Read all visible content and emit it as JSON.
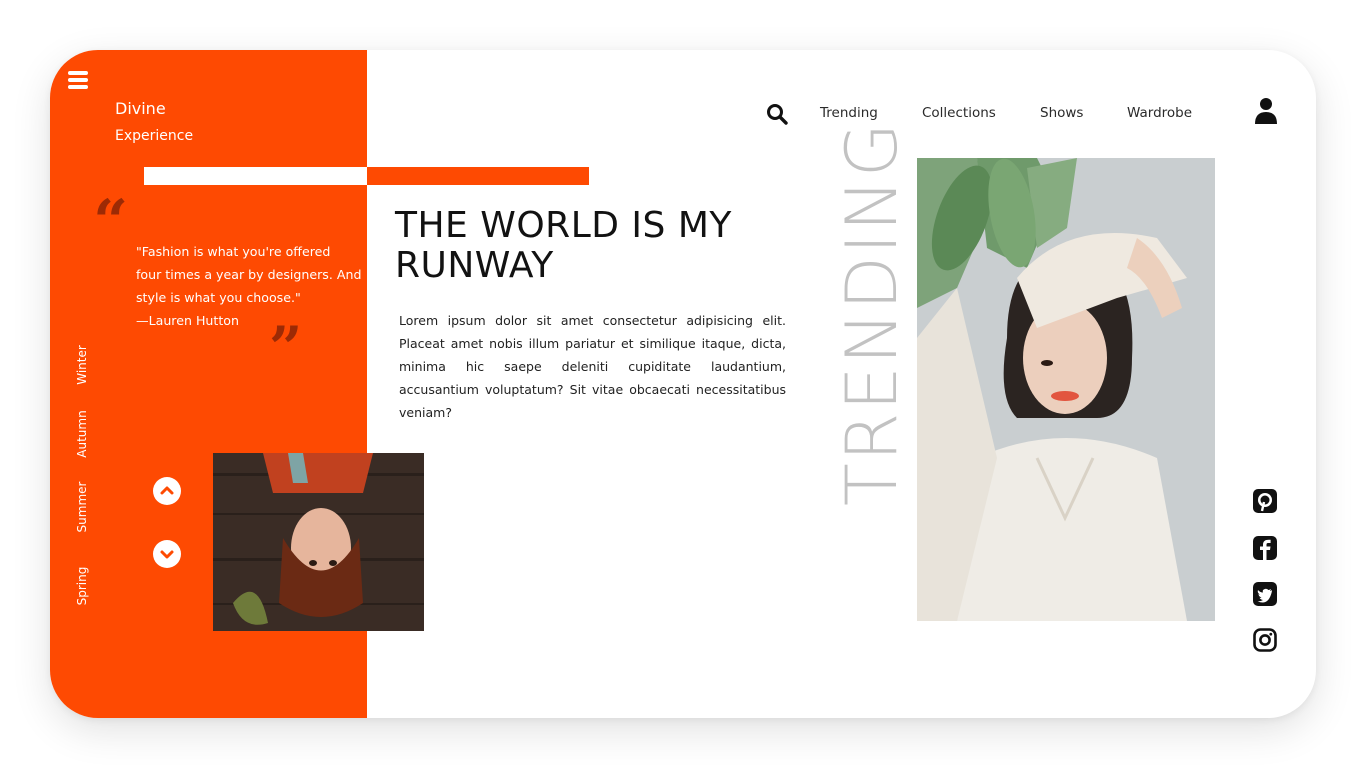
{
  "brand": {
    "title": "Divine",
    "subtitle": "Experience"
  },
  "quote": {
    "line1": "\"Fashion is what you're offered",
    "line2": "four times a year by designers. And",
    "line3": "style is what you choose.\"",
    "author": "—Lauren Hutton"
  },
  "seasons": [
    "Winter",
    "Autumn",
    "Summer",
    "Spring"
  ],
  "nav": {
    "items": [
      "Trending",
      "Collections",
      "Shows",
      "Wardrobe"
    ]
  },
  "hero": {
    "heading_line1": "THE WORLD IS MY",
    "heading_line2": "RUNWAY",
    "body": "Lorem ipsum dolor sit amet consectetur adipisicing elit. Placeat amet nobis illum pariatur et similique itaque, dicta, minima hic saepe deleniti cupiditate laudantium, accusantium voluptatum? Sit vitae obcaecati necessitatibus veniam?"
  },
  "trending_label": "TRENDING",
  "social": [
    "pinterest-icon",
    "facebook-icon",
    "twitter-icon",
    "instagram-icon"
  ],
  "colors": {
    "accent": "#fe4a02",
    "quote_mark": "#9c2a05",
    "trending_text": "#c2c2c2"
  }
}
